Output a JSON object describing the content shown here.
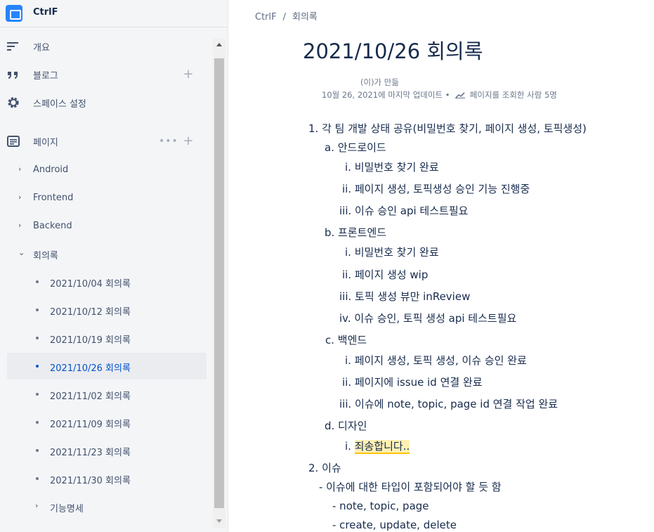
{
  "sidebar": {
    "space_name": "CtrlF",
    "nav": {
      "overview": "개요",
      "blog": "블로그",
      "settings": "스페이스 설정",
      "pages": "페이지"
    },
    "tree": [
      {
        "label": "Android"
      },
      {
        "label": "Frontend"
      },
      {
        "label": "Backend"
      },
      {
        "label": "회의록"
      }
    ],
    "minutes": [
      {
        "label": "2021/10/04 회의록"
      },
      {
        "label": "2021/10/12 회의록"
      },
      {
        "label": "2021/10/19 회의록"
      },
      {
        "label": "2021/10/26 회의록"
      },
      {
        "label": "2021/11/02 회의록"
      },
      {
        "label": "2021/11/09 회의록"
      },
      {
        "label": "2021/11/23 회의록"
      },
      {
        "label": "2021/11/30 회의록"
      }
    ],
    "features": "기능명세",
    "dots": "•••",
    "plus": "+"
  },
  "breadcrumb": {
    "root": "CtrlF",
    "sep": "/",
    "current": "회의록"
  },
  "page": {
    "title": "2021/10/26 회의록",
    "created_by": "(이)가 만듦",
    "updated": "10월 26, 2021에 마지막 업데이트",
    "bullet": "•",
    "views": "페이지를 조회한 사람 5명"
  },
  "body": [
    "1. 각 팀 개발 상태 공유(비밀번호 찾기, 페이지 생성, 토픽생성)",
    "a. 안드로이드",
    "i. 비밀번호 찾기 완료",
    "ii. 페이지 생성, 토픽생성 승인 기능 진행중",
    "iii. 이슈 승인 api 테스트필요",
    "b. 프론트엔드",
    "i. 비밀번호 찾기 완료",
    "ii. 페이지 생성 wip",
    "iii. 토픽 생성 뷰만 inReview",
    "iv. 이슈 승인, 토픽 생성 api 테스트필요",
    "c. 백엔드",
    "i. 페이지 생성, 토픽 생성, 이슈 승인 완료",
    "ii. 페이지에 issue id 연결 완료",
    "iii. 이슈에 note, topic, page id 연결 작업 완료",
    "d. 디자인",
    "i.",
    "죄송합니다..",
    "2. 이슈",
    "- 이슈에 대한 타입이 포함되어야 할 듯 함",
    "- note, topic, page",
    "- create, update, delete"
  ],
  "colors": {
    "accent": "#0052cc",
    "highlight": "#fff0b3",
    "underline": "#ffc400"
  }
}
